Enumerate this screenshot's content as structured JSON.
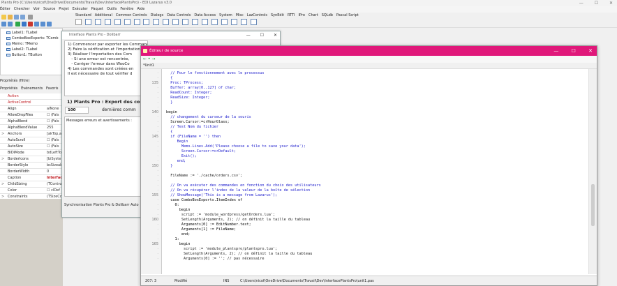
{
  "ide": {
    "title": "Plants Pro (C:\\Users\\nicof\\OneDrive\\Documents\\Travail\\Dev\\InterfacePlantsPro) - EDI Lazarus v3.0",
    "window_controls": [
      "—",
      "☐",
      "✕"
    ],
    "menu": [
      "Éditer",
      "Chercher",
      "Voir",
      "Source",
      "Projet",
      "Exécuter",
      "Paquet",
      "Outils",
      "Fenêtre",
      "Aide"
    ],
    "palette_tabs": [
      "Standard",
      "Additional",
      "Common Controls",
      "Dialogs",
      "Data Controls",
      "Data Access",
      "System",
      "Misc",
      "LazControls",
      "SynEdit",
      "RTTI",
      "IPro",
      "Chart",
      "SQLdb",
      "Pascal Script"
    ]
  },
  "component_tree": {
    "items": [
      "Label1: TLabel",
      "ComboBoxExports: TComb",
      "Memo: TMemo",
      "Label2: TLabel",
      "Button1: TButton"
    ]
  },
  "object_inspector": {
    "title": "Propriétés (filtre)",
    "tabs": [
      "Propriétés",
      "Événements",
      "Favoris"
    ],
    "rows": [
      {
        "name": "Action",
        "value": "",
        "highlight": "red",
        "expander": ""
      },
      {
        "name": "ActiveControl",
        "value": "",
        "highlight": "red",
        "expander": ""
      },
      {
        "name": "Align",
        "value": "alNone",
        "highlight": "",
        "expander": ""
      },
      {
        "name": "AllowDropFiles",
        "value": "☐ (Fals",
        "highlight": "",
        "expander": ""
      },
      {
        "name": "AlphaBlend",
        "value": "☐ (Fals",
        "highlight": "",
        "expander": ""
      },
      {
        "name": "AlphaBlendValue",
        "value": "255",
        "highlight": "",
        "expander": ""
      },
      {
        "name": "Anchors",
        "value": "[akTop,a",
        "highlight": "",
        "expander": ">"
      },
      {
        "name": "AutoScroll",
        "value": "☐ (Fals",
        "highlight": "",
        "expander": ""
      },
      {
        "name": "AutoSize",
        "value": "☐ (Fals",
        "highlight": "",
        "expander": ""
      },
      {
        "name": "BiDiMode",
        "value": "bdLeftTo",
        "highlight": "",
        "expander": ""
      },
      {
        "name": "BorderIcons",
        "value": "[biSyste",
        "highlight": "",
        "expander": ">"
      },
      {
        "name": "BorderStyle",
        "value": "bsSizeab",
        "highlight": "",
        "expander": ""
      },
      {
        "name": "BorderWidth",
        "value": "0",
        "highlight": "",
        "expander": ""
      },
      {
        "name": "Caption",
        "value": "Interface",
        "highlight": "bold",
        "expander": ""
      },
      {
        "name": "ChildSizing",
        "value": "(TContro",
        "highlight": "",
        "expander": ">"
      },
      {
        "name": "Color",
        "value": "☐ clDef",
        "highlight": "",
        "expander": ""
      },
      {
        "name": "Constraints",
        "value": "(TSizeCo",
        "highlight": "",
        "expander": ">"
      }
    ]
  },
  "designer": {
    "title": "Interface Plants Pro - Dolibarr",
    "controls": [
      "—",
      "☐",
      "✕"
    ],
    "memo_lines": [
      "1) Commencer par exporter les Commandes de WooCommerce",
      "2) Faire la vérification et l'importation",
      "3) Réaliser l'importation des Com",
      "   - Si une erreur est rencontrée,",
      "   - Corriger l'erreur dans WooCo",
      "4) Les commandes sont créées en",
      "Il est nécessaire de tout vérifier d"
    ],
    "label1": "1) Plants Pro : Export des com",
    "edit_value": "100",
    "label2": "dernières comm",
    "messages_label": "Messages erreurs et avertissements :",
    "status": "Synchronisation Plants Pro & Dolibarr  Auto"
  },
  "editor": {
    "title": "Éditeur de source",
    "controls": [
      "—",
      "☐",
      "✕"
    ],
    "toolbar": "← • →",
    "tab": "*Unit1",
    "status": {
      "position": "207: 3",
      "modified": "Modifié",
      "mode": "INS",
      "file": "C:\\Users\\nicof\\OneDrive\\Documents\\Travail\\Dev\\InterfacePlantsPro\\unit1.pas"
    },
    "line_numbers": [
      {
        "n": "135",
        "row": 2
      },
      {
        "n": "140",
        "row": 8
      },
      {
        "n": "145",
        "row": 13
      },
      {
        "n": "150",
        "row": 19
      },
      {
        "n": "155",
        "row": 25
      },
      {
        "n": "160",
        "row": 30
      },
      {
        "n": "165",
        "row": 35
      }
    ],
    "code_lines": [
      {
        "t": "  // Pour le fonctionnement avec le processus",
        "c": "comment"
      },
      {
        "t": "  {",
        "c": "comment"
      },
      {
        "t": "  Proc: TProcess;",
        "c": "comment"
      },
      {
        "t": "  Buffer: array[0..127] of char;",
        "c": "comment"
      },
      {
        "t": "  ReadCount: Integer;",
        "c": "comment"
      },
      {
        "t": "  ReadSize: Integer;",
        "c": "comment"
      },
      {
        "t": "  }",
        "c": "comment"
      },
      {
        "t": "",
        "c": "plain"
      },
      {
        "t": "begin",
        "c": "plain"
      },
      {
        "t": "  // changement du curseur de la souris",
        "c": "comment"
      },
      {
        "t": "  Screen.Cursor:=crHourGlass;",
        "c": "plain"
      },
      {
        "t": "  // Test Nom du fichier",
        "c": "comment"
      },
      {
        "t": "  {",
        "c": "comment"
      },
      {
        "t": "  if (FileName = '') then",
        "c": "comment"
      },
      {
        "t": "     Begin",
        "c": "comment"
      },
      {
        "t": "       Memo.Lines.Add('Please choose a file to save your data');",
        "c": "comment"
      },
      {
        "t": "       Screen.Cursor:=crDefault;",
        "c": "comment"
      },
      {
        "t": "       Exit();",
        "c": "comment"
      },
      {
        "t": "     end;",
        "c": "comment"
      },
      {
        "t": "  }",
        "c": "comment"
      },
      {
        "t": "",
        "c": "plain"
      },
      {
        "t": "  FileName := './cache/orders.csv';",
        "c": "mixed"
      },
      {
        "t": "",
        "c": "plain"
      },
      {
        "t": "  // On va exécuter des commandes en fonction du choix des utilisateurs",
        "c": "comment"
      },
      {
        "t": "  // On va récupérer l'index de la valeur de la boîte de sélection",
        "c": "comment"
      },
      {
        "t": "  // ShowMessage('This is a message from Lazarus');",
        "c": "comment"
      },
      {
        "t": "  case ComboBoxExports.ItemIndex of",
        "c": "plain"
      },
      {
        "t": "    0:",
        "c": "plain"
      },
      {
        "t": "      begin",
        "c": "plain"
      },
      {
        "t": "       script := 'module_wordpress/getOrders.lua';",
        "c": "mixed"
      },
      {
        "t": "       SetLength(Arguments, 2); // on définit la taille du tableau",
        "c": "mixed"
      },
      {
        "t": "       Arguments[0] := EditNumber.text;",
        "c": "plain"
      },
      {
        "t": "       Arguments[1] := FileName;",
        "c": "plain"
      },
      {
        "t": "       end;",
        "c": "plain"
      },
      {
        "t": "    1:",
        "c": "plain"
      },
      {
        "t": "      begin",
        "c": "plain"
      },
      {
        "t": "        script := 'module_plantspro/plantspro.lua';",
        "c": "mixed"
      },
      {
        "t": "        SetLength(Arguments, 2); // on définit la taille du tableau",
        "c": "mixed"
      },
      {
        "t": "        Arguments[0] := ''; // pas nécessaire",
        "c": "mixed"
      }
    ]
  },
  "colors": {
    "editor_title": "#e0187a",
    "comment": "#1a1acc",
    "string": "#1a1acc",
    "property_red": "#c0181e"
  }
}
